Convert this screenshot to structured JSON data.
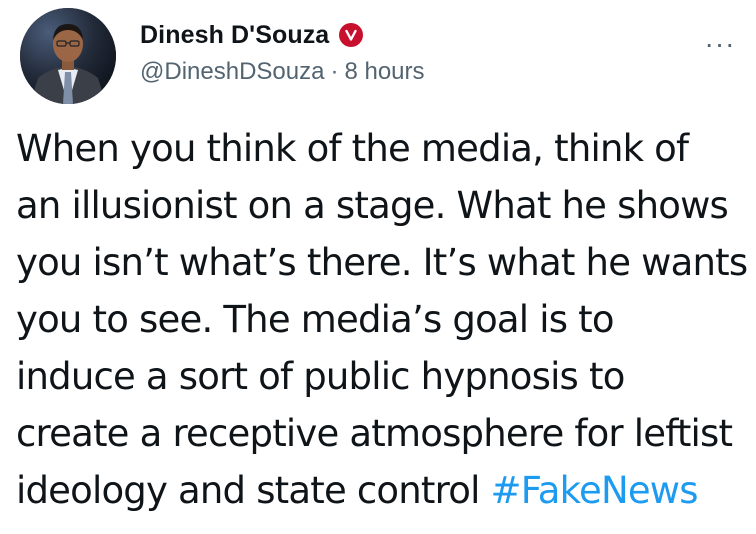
{
  "author": {
    "display_name": "Dinesh D'Souza",
    "handle": "@DineshDSouza",
    "separator": "·",
    "time": "8 hours",
    "verified_icon": "verified-badge-icon",
    "verified_color": "#c8102e",
    "verified_letter": "V"
  },
  "menu": {
    "more_label": "···"
  },
  "tweet": {
    "lines": [
      "When you think of the media, think of",
      "an illusionist on a stage. What he shows",
      "you isn’t what’s there. It’s what he wants",
      "you to see. The media’s goal is to",
      "induce a sort of public hypnosis to",
      "create a receptive atmosphere for leftist",
      "ideology and state control "
    ],
    "hashtag": "#FakeNews",
    "hashtag_color": "#1d9bf0"
  }
}
